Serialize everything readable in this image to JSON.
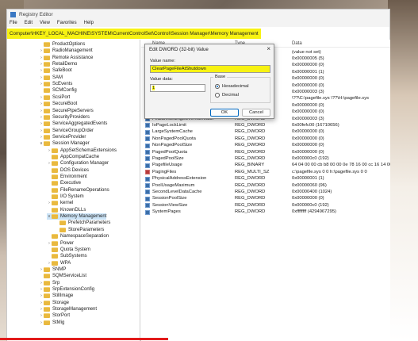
{
  "window": {
    "title": "Registry Editor",
    "menu": [
      "File",
      "Edit",
      "View",
      "Favorites",
      "Help"
    ],
    "address": "Computer\\HKEY_LOCAL_MACHINE\\SYSTEM\\CurrentControlSet\\Control\\Session Manager\\Memory Management"
  },
  "tree": [
    {
      "label": "ProductOptions",
      "depth": 0,
      "chev": false
    },
    {
      "label": "RadioManagement",
      "depth": 0,
      "chev": true
    },
    {
      "label": "Remote Assistance",
      "depth": 0,
      "chev": true
    },
    {
      "label": "RetailDemo",
      "depth": 0,
      "chev": true
    },
    {
      "label": "SafeBoot",
      "depth": 0,
      "chev": true
    },
    {
      "label": "SAM",
      "depth": 0,
      "chev": true
    },
    {
      "label": "ScEvents",
      "depth": 0,
      "chev": true
    },
    {
      "label": "SCMConfig",
      "depth": 0,
      "chev": false
    },
    {
      "label": "ScsiPort",
      "depth": 0,
      "chev": true
    },
    {
      "label": "SecureBoot",
      "depth": 0,
      "chev": true
    },
    {
      "label": "SecurePipeServers",
      "depth": 0,
      "chev": true
    },
    {
      "label": "SecurityProviders",
      "depth": 0,
      "chev": true
    },
    {
      "label": "ServiceAggregatedEvents",
      "depth": 0,
      "chev": true
    },
    {
      "label": "ServiceGroupOrder",
      "depth": 0,
      "chev": true
    },
    {
      "label": "ServiceProvider",
      "depth": 0,
      "chev": true
    },
    {
      "label": "Session Manager",
      "depth": 0,
      "chev": true,
      "open": true
    },
    {
      "label": "AppSetSchemaExtensions",
      "depth": 1,
      "chev": true
    },
    {
      "label": "AppCompatCache",
      "depth": 1,
      "chev": false
    },
    {
      "label": "Configuration Manager",
      "depth": 1,
      "chev": true
    },
    {
      "label": "DOS Devices",
      "depth": 1,
      "chev": false
    },
    {
      "label": "Environment",
      "depth": 1,
      "chev": false
    },
    {
      "label": "Executive",
      "depth": 1,
      "chev": false
    },
    {
      "label": "FileRenameOperations",
      "depth": 1,
      "chev": false
    },
    {
      "label": "I/O System",
      "depth": 1,
      "chev": false
    },
    {
      "label": "kernel",
      "depth": 1,
      "chev": true
    },
    {
      "label": "KnownDLLs",
      "depth": 1,
      "chev": false
    },
    {
      "label": "Memory Management",
      "depth": 1,
      "chev": true,
      "open": true,
      "selected": true
    },
    {
      "label": "PrefetchParameters",
      "depth": 2,
      "chev": false
    },
    {
      "label": "StoreParameters",
      "depth": 2,
      "chev": false
    },
    {
      "label": "NamespaceSeparation",
      "depth": 1,
      "chev": false
    },
    {
      "label": "Power",
      "depth": 1,
      "chev": true
    },
    {
      "label": "Quota System",
      "depth": 1,
      "chev": false
    },
    {
      "label": "SubSystems",
      "depth": 1,
      "chev": false
    },
    {
      "label": "WPA",
      "depth": 1,
      "chev": true
    },
    {
      "label": "SNMP",
      "depth": 0,
      "chev": true
    },
    {
      "label": "SQMServiceList",
      "depth": 0,
      "chev": false
    },
    {
      "label": "Srp",
      "depth": 0,
      "chev": true
    },
    {
      "label": "SrpExtensionConfig",
      "depth": 0,
      "chev": true
    },
    {
      "label": "StillImage",
      "depth": 0,
      "chev": true
    },
    {
      "label": "Storage",
      "depth": 0,
      "chev": true
    },
    {
      "label": "StorageManagement",
      "depth": 0,
      "chev": true
    },
    {
      "label": "StorPort",
      "depth": 0,
      "chev": true
    },
    {
      "label": "StMig",
      "depth": 0,
      "chev": true
    }
  ],
  "values": {
    "columns": [
      "Name",
      "Type",
      "Data"
    ],
    "rows": [
      {
        "name": "",
        "type": "",
        "data": "(value not set)",
        "icon": "none"
      },
      {
        "name": "",
        "type": "",
        "data": "0x00000005 (5)",
        "icon": "none"
      },
      {
        "name": "",
        "type": "",
        "data": "0x00000000 (0)",
        "icon": "none"
      },
      {
        "name": "",
        "type": "",
        "data": "0x00000001 (1)",
        "icon": "none"
      },
      {
        "name": "",
        "type": "",
        "data": "0x00000000 (0)",
        "icon": "none"
      },
      {
        "name": "",
        "type": "",
        "data": "0x00000000 (0)",
        "icon": "none"
      },
      {
        "name": "",
        "type": "",
        "data": "0x00000003 (3)",
        "icon": "none"
      },
      {
        "name": "",
        "type": "",
        "data": "\\??\\C:\\pagefile.sys \\??\\H:\\pagefile.sys",
        "icon": "none"
      },
      {
        "name": "",
        "type": "",
        "data": "0x00000000 (0)",
        "icon": "none"
      },
      {
        "name": "",
        "type": "",
        "data": "0x00000000 (0)",
        "icon": "none"
      },
      {
        "name": "FeatureSettingsOverrideMask",
        "type": "REG_DWORD",
        "data": "0x00000003 (3)",
        "icon": "dw"
      },
      {
        "name": "IoPageLockLimit",
        "type": "REG_DWORD",
        "data": "0x00fefc00 (16710656)",
        "icon": "dw"
      },
      {
        "name": "LargeSystemCache",
        "type": "REG_DWORD",
        "data": "0x00000000 (0)",
        "icon": "dw"
      },
      {
        "name": "NonPagedPoolQuota",
        "type": "REG_DWORD",
        "data": "0x00000000 (0)",
        "icon": "dw"
      },
      {
        "name": "NonPagedPoolSize",
        "type": "REG_DWORD",
        "data": "0x00000000 (0)",
        "icon": "dw"
      },
      {
        "name": "PagedPoolQuota",
        "type": "REG_DWORD",
        "data": "0x00000000 (0)",
        "icon": "dw"
      },
      {
        "name": "PagedPoolSize",
        "type": "REG_DWORD",
        "data": "0x000000c0 (192)",
        "icon": "dw"
      },
      {
        "name": "PagefileUsage",
        "type": "REG_BINARY",
        "data": "64 04 00 00 cb b8 00 00 0e 78 16 00 cc 16 14 00 c6 f0...",
        "icon": "dw"
      },
      {
        "name": "PagingFiles",
        "type": "REG_MULTI_SZ",
        "data": "c:\\pagefile.sys 0 0 h:\\pagefile.sys 0 0",
        "icon": "sz"
      },
      {
        "name": "PhysicalAddressExtension",
        "type": "REG_DWORD",
        "data": "0x00000001 (1)",
        "icon": "dw"
      },
      {
        "name": "PoolUsageMaximum",
        "type": "REG_DWORD",
        "data": "0x00000060 (96)",
        "icon": "dw"
      },
      {
        "name": "SecondLevelDataCache",
        "type": "REG_DWORD",
        "data": "0x00000400 (1024)",
        "icon": "dw"
      },
      {
        "name": "SessionPoolSize",
        "type": "REG_DWORD",
        "data": "0x00000000 (0)",
        "icon": "dw"
      },
      {
        "name": "SessionViewSize",
        "type": "REG_DWORD",
        "data": "0x000000c0 (192)",
        "icon": "dw"
      },
      {
        "name": "SystemPages",
        "type": "REG_DWORD",
        "data": "0xffffffff (4294967295)",
        "icon": "dw"
      }
    ]
  },
  "dialog": {
    "title": "Edit DWORD (32-bit) Value",
    "close": "×",
    "name_label": "Value name:",
    "name_value": "ClearPageFileAtShutdown",
    "data_label": "Value data:",
    "data_value": "1",
    "base_label": "Base",
    "radio_hex": "Hexadecimal",
    "radio_dec": "Decimal",
    "ok": "OK",
    "cancel": "Cancel"
  },
  "colors": {
    "highlight": "#f7f212",
    "accent": "#0067c0",
    "progress": "#e21b1b"
  }
}
